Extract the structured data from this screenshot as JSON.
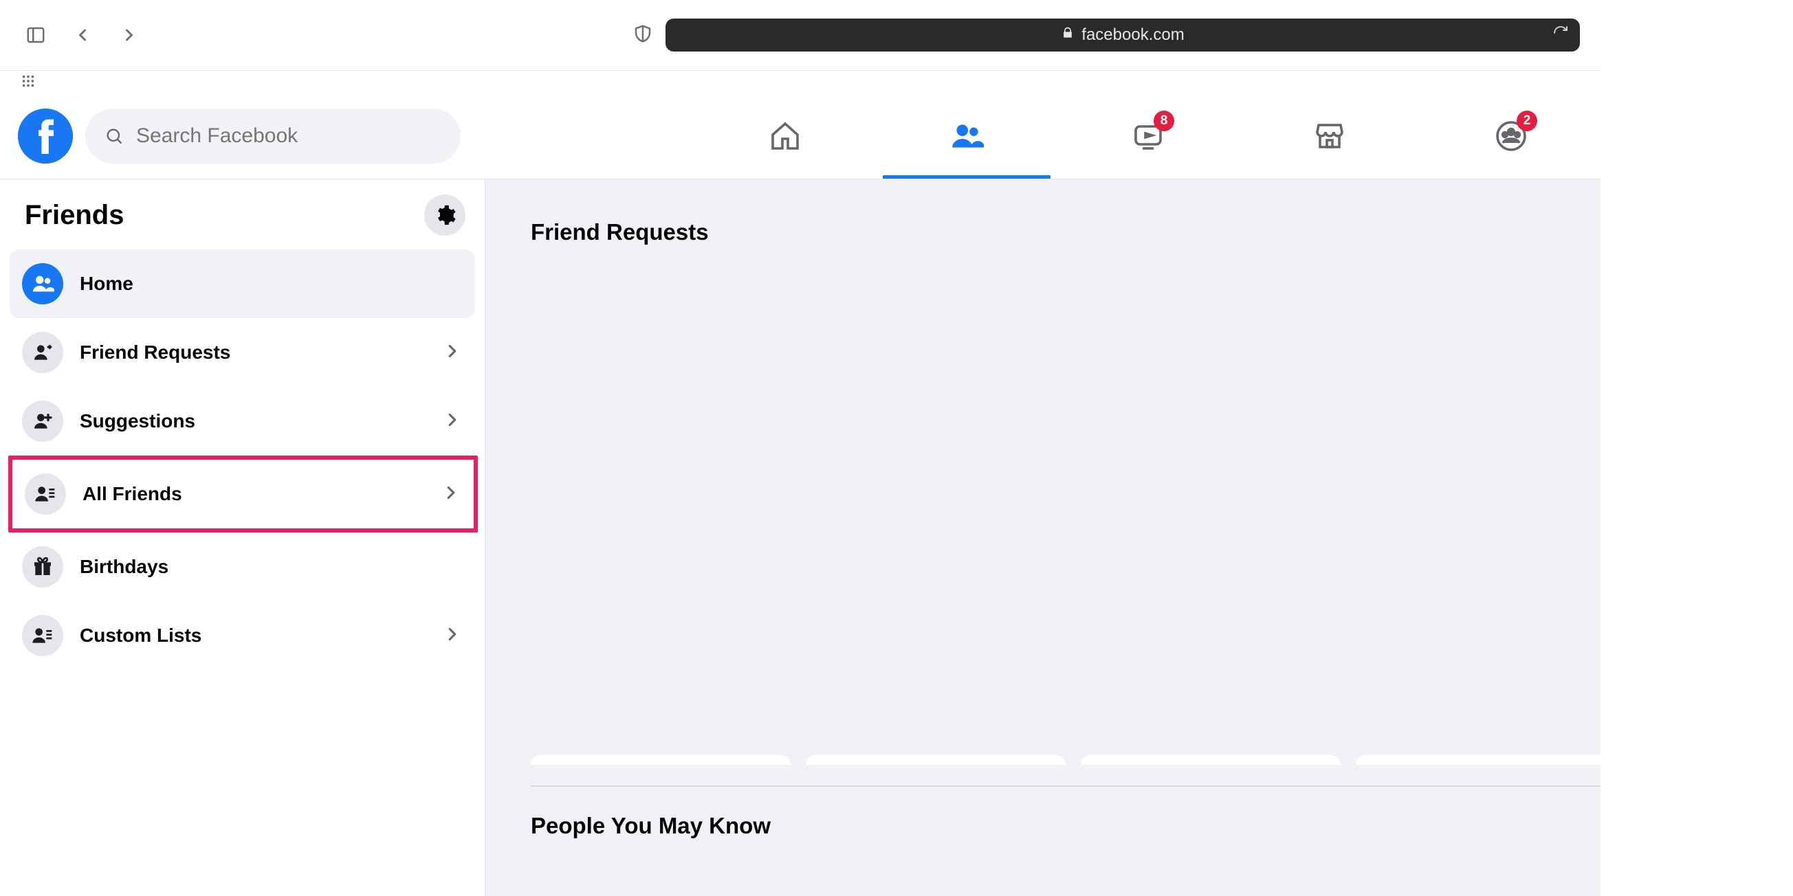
{
  "browser": {
    "url_display": "facebook.com"
  },
  "search": {
    "placeholder": "Search Facebook"
  },
  "topnav": {
    "watch_badge": "8",
    "groups_badge": "2"
  },
  "sidebar": {
    "title": "Friends",
    "items": [
      {
        "label": "Home",
        "icon": "friends",
        "active": true,
        "chevron": false
      },
      {
        "label": "Friend Requests",
        "icon": "friend-request",
        "active": false,
        "chevron": true
      },
      {
        "label": "Suggestions",
        "icon": "friend-add",
        "active": false,
        "chevron": true
      },
      {
        "label": "All Friends",
        "icon": "friend-list",
        "active": false,
        "chevron": true,
        "highlighted": true
      },
      {
        "label": "Birthdays",
        "icon": "gift",
        "active": false,
        "chevron": false
      },
      {
        "label": "Custom Lists",
        "icon": "friend-list",
        "active": false,
        "chevron": true
      }
    ]
  },
  "main": {
    "section1_title": "Friend Requests",
    "section2_title": "People You May Know"
  }
}
